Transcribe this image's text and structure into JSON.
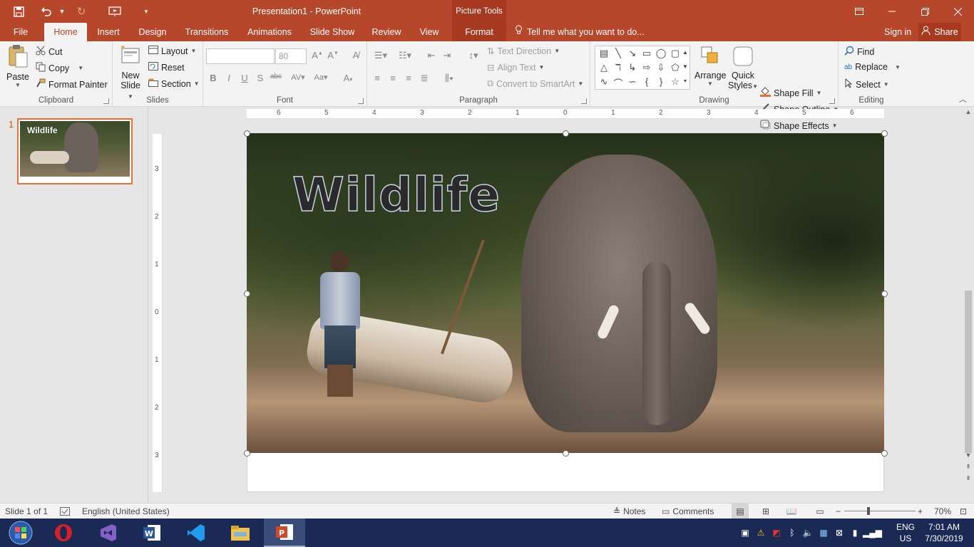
{
  "app": {
    "title": "Presentation1 - PowerPoint",
    "context_tab_group": "Picture Tools"
  },
  "tabs": [
    {
      "label": "File"
    },
    {
      "label": "Home"
    },
    {
      "label": "Insert"
    },
    {
      "label": "Design"
    },
    {
      "label": "Transitions"
    },
    {
      "label": "Animations"
    },
    {
      "label": "Slide Show"
    },
    {
      "label": "Review"
    },
    {
      "label": "View"
    },
    {
      "label": "Format"
    }
  ],
  "tell_me": "Tell me what you want to do...",
  "sign_in": "Sign in",
  "share": "Share",
  "ribbon": {
    "clipboard": {
      "label": "Clipboard",
      "paste": "Paste",
      "cut": "Cut",
      "copy": "Copy",
      "format_painter": "Format Painter"
    },
    "slides": {
      "label": "Slides",
      "new_slide_line1": "New",
      "new_slide_line2": "Slide",
      "layout": "Layout",
      "reset": "Reset",
      "section": "Section"
    },
    "font": {
      "label": "Font",
      "font_name": "",
      "font_size": "80"
    },
    "paragraph": {
      "label": "Paragraph",
      "text_direction": "Text Direction",
      "align_text": "Align Text",
      "convert_smartart": "Convert to SmartArt"
    },
    "drawing": {
      "label": "Drawing",
      "arrange": "Arrange",
      "quick_styles_line1": "Quick",
      "quick_styles_line2": "Styles",
      "shape_fill": "Shape Fill",
      "shape_outline": "Shape Outline",
      "shape_effects": "Shape Effects"
    },
    "editing": {
      "label": "Editing",
      "find": "Find",
      "replace": "Replace",
      "select": "Select"
    }
  },
  "thumbnail": {
    "number": "1",
    "title": "Wildlife"
  },
  "slide": {
    "title": "Wildlife"
  },
  "ruler": {
    "h_numbers": [
      "6",
      "5",
      "4",
      "3",
      "2",
      "1",
      "0",
      "1",
      "2",
      "3",
      "4",
      "5",
      "6"
    ],
    "v_numbers": [
      "3",
      "2",
      "1",
      "0",
      "1",
      "2",
      "3"
    ]
  },
  "status": {
    "slide_info": "Slide 1 of 1",
    "language": "English (United States)",
    "notes": "Notes",
    "comments": "Comments",
    "zoom": "70%"
  },
  "taskbar": {
    "lang_line1": "ENG",
    "lang_line2": "US",
    "time": "7:01 AM",
    "date": "7/30/2019"
  },
  "colors": {
    "accent": "#b7472a",
    "taskbar": "#1b2a55"
  }
}
